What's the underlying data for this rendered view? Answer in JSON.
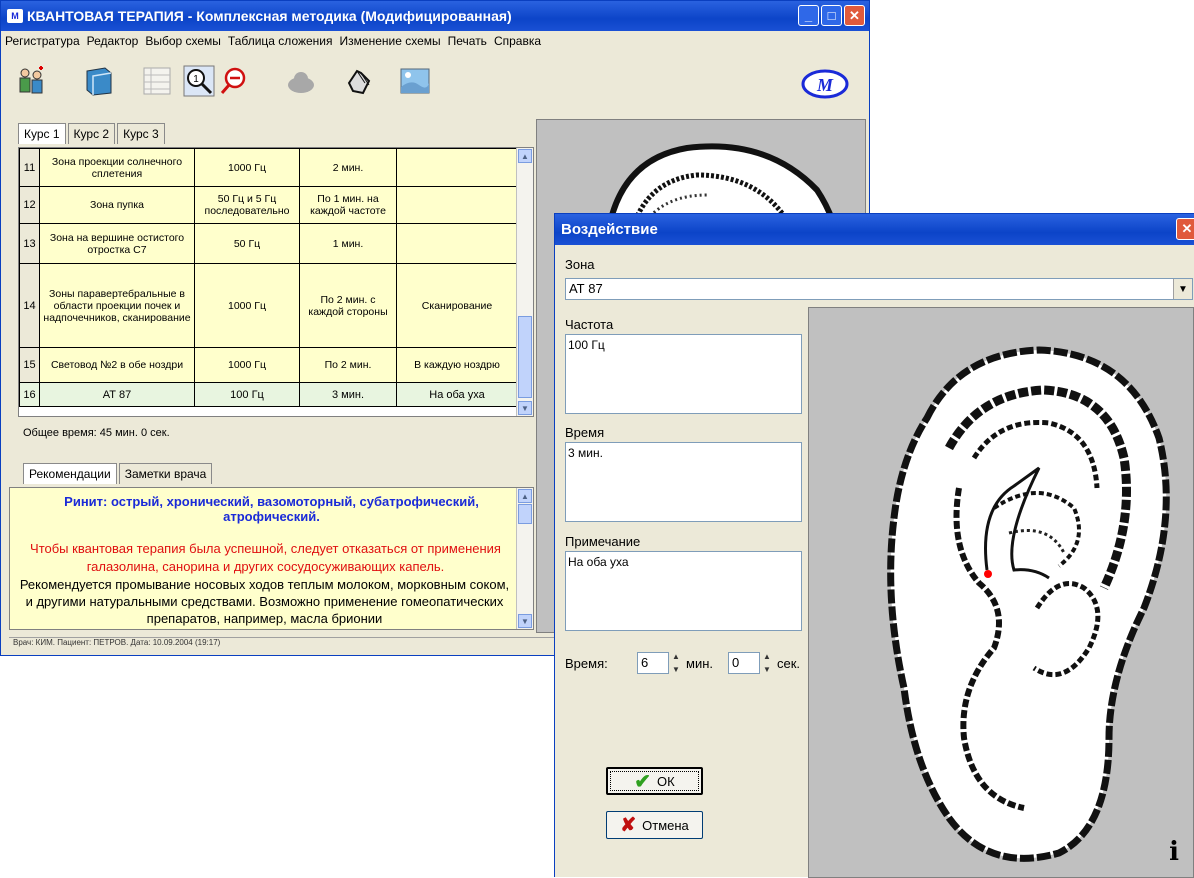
{
  "main": {
    "title": "КВАНТОВАЯ ТЕРАПИЯ - Комплексная методика (Модифицированная)",
    "menu": [
      "Регистратура",
      "Редактор",
      "Выбор схемы",
      "Таблица сложения",
      "Изменение схемы",
      "Печать",
      "Справка"
    ],
    "toolbar_icons": [
      "patients-icon",
      "book-icon",
      "table-icon",
      "zoom-in-icon",
      "zoom-out-icon",
      "cloud-icon",
      "hand-icon",
      "image-icon"
    ],
    "course_tabs": [
      "Курс 1",
      "Курс 2",
      "Курс 3"
    ],
    "rows": [
      {
        "num": "11",
        "zone": "Зона проекции солнечного сплетения",
        "freq": "1000 Гц",
        "time": "2 мин.",
        "note": ""
      },
      {
        "num": "12",
        "zone": "Зона пупка",
        "freq": "50 Гц и 5 Гц последовательно",
        "time": "По 1 мин. на каждой частоте",
        "note": ""
      },
      {
        "num": "13",
        "zone": "Зона на вершине остистого отростка С7",
        "freq": "50 Гц",
        "time": "1 мин.",
        "note": ""
      },
      {
        "num": "14",
        "zone": "Зоны паравертебральные в области проекции почек и надпочечников, сканирование",
        "freq": "1000 Гц",
        "time": "По 2 мин. с каждой стороны",
        "note": "Сканирование"
      },
      {
        "num": "15",
        "zone": "Световод №2 в обе ноздри",
        "freq": "1000 Гц",
        "time": "По 2 мин.",
        "note": "В каждую ноздрю"
      },
      {
        "num": "16",
        "zone": "АТ 87",
        "freq": "100 Гц",
        "time": "3 мин.",
        "note": "На оба уха"
      }
    ],
    "total_time": "Общее время: 45 мин. 0 сек.",
    "rec_tabs": [
      "Рекомендации",
      "Заметки врача"
    ],
    "rec_heading": "Ринит: острый, хронический, вазомоторный, субатрофический, атрофический.",
    "rec_red": "Чтобы квантовая терапия была успешной, следует отказаться от применения галазолина, санорина и других сосудосуживающих капель.",
    "rec_black": "Рекомендуется промывание носовых ходов теплым молоком, морковным соком, и другими натуральными средствами. Возможно применение гомеопатических препаратов, например, масла брионии",
    "status": "Врач: КИМ.    Пациент: ПЕТРОВ.    Дата: 10.09.2004 (19:17)"
  },
  "dialog": {
    "title": "Воздействие",
    "zone_label": "Зона",
    "zone_value": "АТ 87",
    "freq_label": "Частота",
    "freq_value": "100 Гц",
    "time_label": "Время",
    "time_value": "3 мин.",
    "note_label": "Примечание",
    "note_value": "На оба уха",
    "duration_label": "Время:",
    "minutes_value": "6",
    "minutes_unit": "мин.",
    "seconds_value": "0",
    "seconds_unit": "сек.",
    "ok_label": "ОК",
    "cancel_label": "Отмена",
    "info_glyph": "i"
  },
  "colors": {
    "title_bar": "#0c44c8",
    "table_bg": "#ffffcc",
    "heading_blue": "#1a2ad8",
    "warning_red": "#e01010",
    "marker": "#ff0000"
  }
}
